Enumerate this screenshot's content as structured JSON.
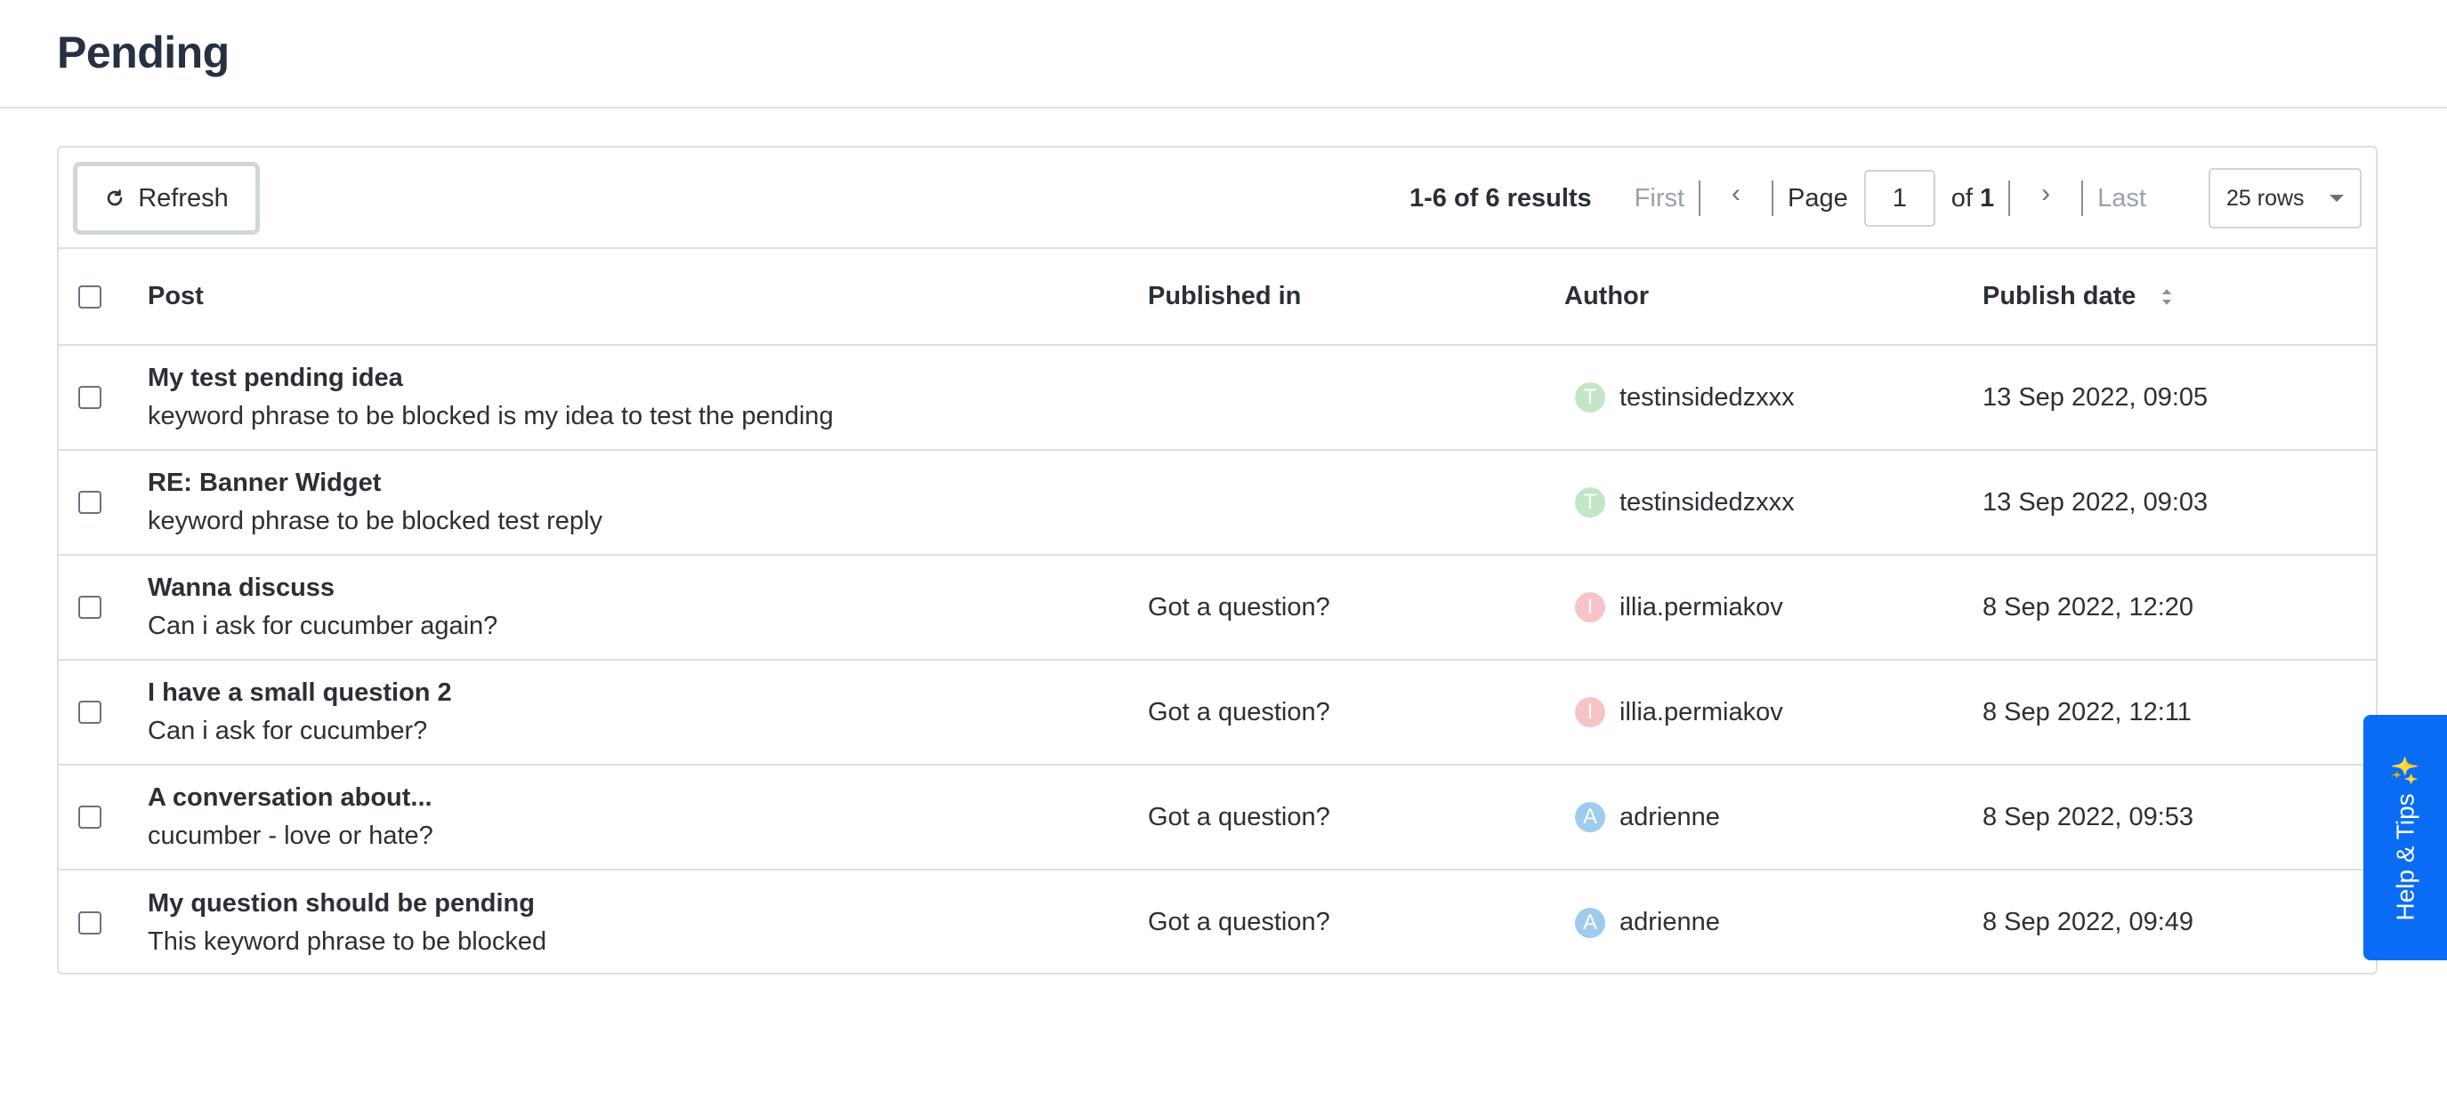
{
  "page": {
    "title": "Pending"
  },
  "toolbar": {
    "refresh_label": "Refresh",
    "results_text": "1-6 of 6 results",
    "first_label": "First",
    "prev_icon": "chevron-left-icon",
    "page_label": "Page",
    "page_value": "1",
    "of_label": "of",
    "total_pages": "1",
    "next_icon": "chevron-right-icon",
    "last_label": "Last",
    "rows_label": "25 rows"
  },
  "table": {
    "headers": {
      "post": "Post",
      "published_in": "Published in",
      "author": "Author",
      "publish_date": "Publish date"
    },
    "rows": [
      {
        "title": "My test pending idea",
        "body": "keyword phrase to be blocked is my idea to test the pending",
        "published_in": "",
        "author": "testinsidedzxxx",
        "initial": "T",
        "avatar_color": "#c3e6c6",
        "date": "13 Sep 2022, 09:05"
      },
      {
        "title": "RE: Banner Widget",
        "body": "keyword phrase to be blocked test reply",
        "published_in": "",
        "author": "testinsidedzxxx",
        "initial": "T",
        "avatar_color": "#c3e6c6",
        "date": "13 Sep 2022, 09:03"
      },
      {
        "title": "Wanna discuss",
        "body": "Can i ask for cucumber again?",
        "published_in": "Got a question?",
        "author": "illia.permiakov",
        "initial": "I",
        "avatar_color": "#f6c4c6",
        "date": "8 Sep 2022, 12:20"
      },
      {
        "title": "I have a small question 2",
        "body": "Can i ask for cucumber?",
        "published_in": "Got a question?",
        "author": "illia.permiakov",
        "initial": "I",
        "avatar_color": "#f6c4c6",
        "date": "8 Sep 2022, 12:11"
      },
      {
        "title": "A conversation about...",
        "body": "cucumber - love or hate?",
        "published_in": "Got a question?",
        "author": "adrienne",
        "initial": "A",
        "avatar_color": "#9fcbed",
        "date": "8 Sep 2022, 09:53"
      },
      {
        "title": "My question should be pending",
        "body": "This keyword phrase to be blocked",
        "published_in": "Got a question?",
        "author": "adrienne",
        "initial": "A",
        "avatar_color": "#9fcbed",
        "date": "8 Sep 2022, 09:49"
      }
    ]
  },
  "help": {
    "label": "Help & Tips",
    "spark": "✨"
  },
  "colors": {
    "accent": "#0a6cf5",
    "border": "#dcdfe3"
  }
}
